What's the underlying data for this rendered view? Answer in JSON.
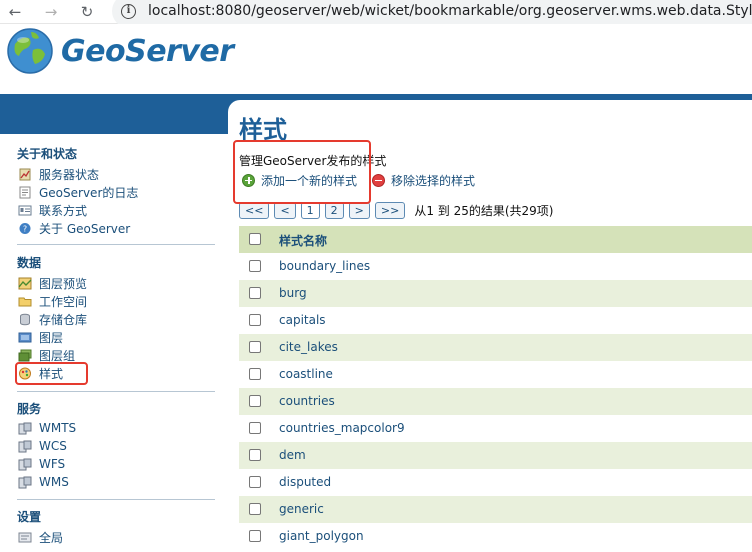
{
  "browser": {
    "url": "localhost:8080/geoserver/web/wicket/bookmarkable/org.geoserver.wms.web.data.StylePag",
    "back_glyph": "←",
    "forward_glyph": "→",
    "reload_glyph": "↻",
    "info_glyph": "i"
  },
  "app": {
    "logo_text": "GeoServer",
    "brand_color": "#1e5f98"
  },
  "sidebar": {
    "sections": [
      {
        "title": "关于和状态",
        "items": [
          {
            "label": "服务器状态",
            "icon": "server-status-icon"
          },
          {
            "label": "GeoServer的日志",
            "icon": "log-icon"
          },
          {
            "label": "联系方式",
            "icon": "contact-icon"
          },
          {
            "label": "关于 GeoServer",
            "icon": "about-icon"
          }
        ]
      },
      {
        "title": "数据",
        "items": [
          {
            "label": "图层预览",
            "icon": "layer-preview-icon"
          },
          {
            "label": "工作空间",
            "icon": "folder-icon"
          },
          {
            "label": "存储仓库",
            "icon": "store-icon"
          },
          {
            "label": "图层",
            "icon": "layer-icon"
          },
          {
            "label": "图层组",
            "icon": "layer-group-icon"
          },
          {
            "label": "样式",
            "icon": "style-icon"
          }
        ]
      },
      {
        "title": "服务",
        "items": [
          {
            "label": "WMTS",
            "icon": "service-icon"
          },
          {
            "label": "WCS",
            "icon": "service-icon"
          },
          {
            "label": "WFS",
            "icon": "service-icon"
          },
          {
            "label": "WMS",
            "icon": "service-icon"
          }
        ]
      },
      {
        "title": "设置",
        "items": [
          {
            "label": "全局",
            "icon": "global-icon"
          }
        ]
      }
    ]
  },
  "main": {
    "title": "样式",
    "description": "管理GeoServer发布的样式",
    "add_label": "添加一个新的样式",
    "remove_label": "移除选择的样式",
    "pager": {
      "first": "<<",
      "prev": "<",
      "pages": [
        "1",
        "2"
      ],
      "next": ">",
      "last": ">>",
      "info": "从1 到 25的结果(共29项)"
    },
    "table": {
      "header": "样式名称",
      "rows": [
        "boundary_lines",
        "burg",
        "capitals",
        "cite_lakes",
        "coastline",
        "countries",
        "countries_mapcolor9",
        "dem",
        "disputed",
        "generic",
        "giant_polygon"
      ]
    }
  }
}
